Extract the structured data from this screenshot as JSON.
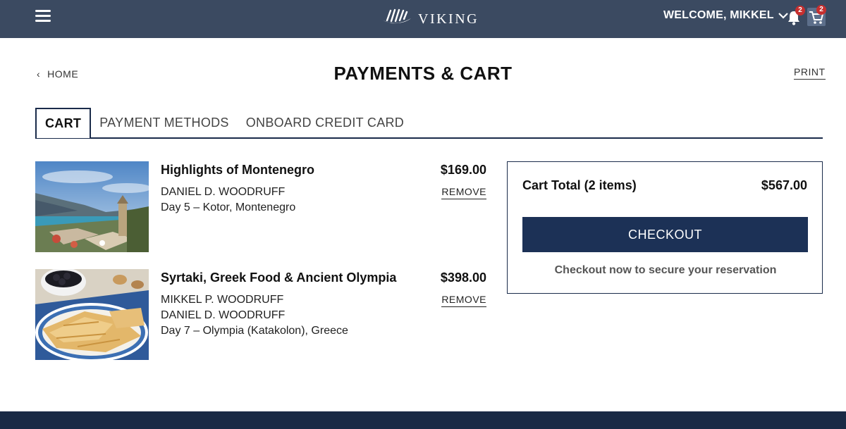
{
  "header": {
    "brand_name": "VIKING",
    "welcome_text": "WELCOME, MIKKEL",
    "notification_count": "2",
    "cart_count": "2"
  },
  "page": {
    "back_label": "HOME",
    "title": "PAYMENTS & CART",
    "print_label": "PRINT"
  },
  "tabs": [
    {
      "label": "CART",
      "active": true
    },
    {
      "label": "PAYMENT METHODS",
      "active": false
    },
    {
      "label": "ONBOARD CREDIT CARD",
      "active": false
    }
  ],
  "cart_items": [
    {
      "title": "Highlights of Montenegro",
      "price": "$169.00",
      "guests": [
        "DANIEL D. WOODRUFF"
      ],
      "day": "Day 5 – Kotor, Montenegro",
      "remove_label": "REMOVE",
      "photo": "coastal-town-bay-photo"
    },
    {
      "title": "Syrtaki, Greek Food & Ancient Olympia",
      "price": "$398.00",
      "guests": [
        "MIKKEL P. WOODRUFF",
        "DANIEL D. WOODRUFF"
      ],
      "day": "Day 7 – Olympia (Katakolon), Greece",
      "remove_label": "REMOVE",
      "photo": "greek-pastry-and-olives-photo"
    }
  ],
  "summary": {
    "label": "Cart Total (2 items)",
    "total": "$567.00",
    "checkout_label": "CHECKOUT",
    "note": "Checkout now to secure your reservation"
  },
  "colors": {
    "header_bg": "#3b4a61",
    "primary_navy": "#1c3156",
    "badge_red": "#c62f2f",
    "footer_bg": "#1a2a45"
  }
}
